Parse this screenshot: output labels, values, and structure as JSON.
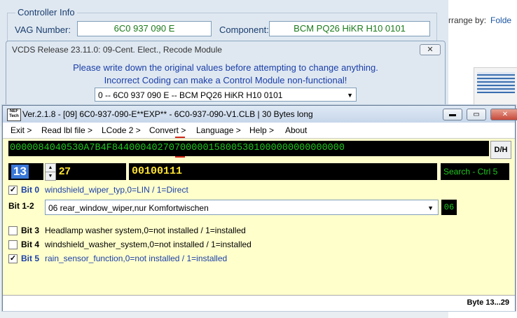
{
  "controller_info": {
    "group_title": "Controller Info",
    "vag_label": "VAG Number:",
    "vag_value": "6C0 937 090 E",
    "component_label": "Component:",
    "component_value": "BCM PQ26 HiKR H10 0101"
  },
  "explorer": {
    "arrange_label": "rrange by:",
    "arrange_value": "Folde"
  },
  "recode_window": {
    "title": "VCDS Release 23.11.0: 09-Cent. Elect.,  Recode Module",
    "close_label": "✕",
    "warning_line1": "Please write down the original values before attempting to change anything.",
    "warning_line2": "Incorrect Coding can make a Control Module non-functional!",
    "module_select": "0 -- 6C0 937 090 E -- BCM PQ26 HiKR H10 0101"
  },
  "nef_window": {
    "logo_text": "NEF Tech",
    "title": "Ver.2.1.8 - [09] 6C0-937-090-E**EXP** - 6C0-937-090-V1.CLB | 30 Bytes long",
    "menu": [
      "Exit >",
      "Read lbl file >",
      "LCode 2 >",
      "Convert >",
      "Language >",
      "Help >",
      "About"
    ],
    "hex_string": "0000084040530A7B4F84400040270700000158005301000000000000000",
    "dh_button": "D/H",
    "byte_number": "13",
    "byte_decimal": "27",
    "byte_binary": "00100111",
    "search_label": "Search - Ctrl 5",
    "bits": [
      {
        "label": "Bit 0",
        "checked": true,
        "text": "windshield_wiper_typ,0=LIN / 1=Direct"
      },
      {
        "label": "Bit 3",
        "checked": false,
        "text": "Headlamp washer system,0=not installed / 1=installed"
      },
      {
        "label": "Bit 4",
        "checked": false,
        "text": "windshield_washer_system,0=not installed / 1=installed"
      },
      {
        "label": "Bit 5",
        "checked": true,
        "text": "rain_sensor_function,0=not installed / 1=installed"
      }
    ],
    "bit12_label": "Bit 1-2",
    "bit12_select": "06 rear_window_wiper,nur Komfortwischen",
    "bit12_value": "06",
    "status_byte": "Byte 13...29"
  },
  "colors": {
    "code_green": "#1ec81e",
    "code_yellow": "#ffe433",
    "link_blue": "#1a3ea8",
    "panel_yellow": "#ffffcc"
  }
}
